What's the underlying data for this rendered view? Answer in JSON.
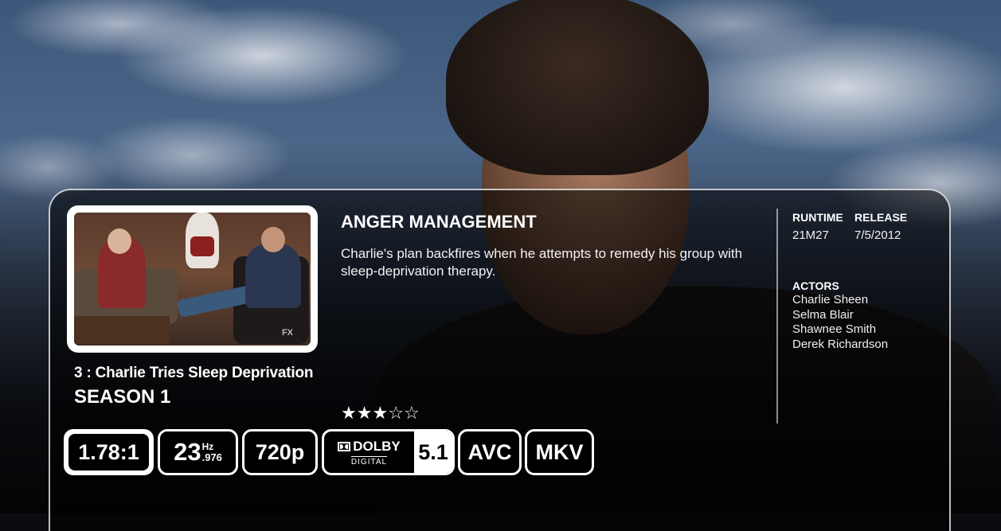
{
  "show": {
    "title": "ANGER MANAGEMENT"
  },
  "episode": {
    "title": "3 : Charlie Tries Sleep Deprivation",
    "season": "SEASON 1",
    "plot": "Charlie's plan backfires when he attempts to remedy his group with sleep-deprivation therapy.",
    "rating": {
      "stars": 3,
      "max": 5
    }
  },
  "meta": {
    "runtime_label": "RUNTIME",
    "runtime_value": "21M27",
    "release_label": "RELEASE",
    "release_value": "7/5/2012",
    "actors_label": "ACTORS",
    "actors": [
      "Charlie Sheen",
      "Selma Blair",
      "Shawnee Smith",
      "Derek Richardson"
    ]
  },
  "flags": {
    "aspect": "1.78:1",
    "fps_int": "23",
    "fps_unit": "Hz",
    "fps_dec": ".976",
    "resolution": "720p",
    "audio_brand": "DOLBY",
    "audio_sub": "DIGITAL",
    "audio_channels": "5.1",
    "video_codec": "AVC",
    "container": "MKV"
  },
  "icons": {
    "star_full": "★",
    "star_empty": "☆",
    "audio_logo": "dolby-double-d-icon"
  },
  "watermark": "FX"
}
